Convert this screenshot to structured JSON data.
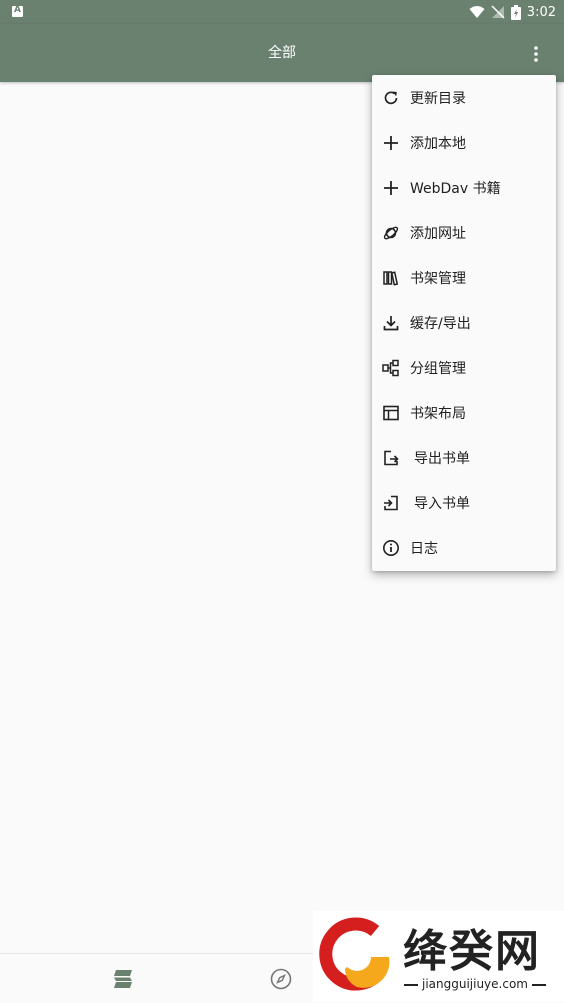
{
  "status_bar": {
    "left_badge": "A",
    "time": "3:02"
  },
  "app_bar": {
    "title": "全部",
    "more_icon": "more-vert-icon"
  },
  "menu": {
    "items": [
      {
        "label": "更新目录",
        "icon": "refresh-icon"
      },
      {
        "label": "添加本地",
        "icon": "plus-icon"
      },
      {
        "label": "WebDav 书籍",
        "icon": "plus-icon"
      },
      {
        "label": "添加网址",
        "icon": "planet-icon"
      },
      {
        "label": "书架管理",
        "icon": "bookshelf-icon"
      },
      {
        "label": "缓存/导出",
        "icon": "download-icon"
      },
      {
        "label": "分组管理",
        "icon": "group-icon"
      },
      {
        "label": "书架布局",
        "icon": "layout-icon"
      },
      {
        "label": "导出书单",
        "icon": "export-icon"
      },
      {
        "label": "导入书单",
        "icon": "import-icon"
      },
      {
        "label": "日志",
        "icon": "info-icon"
      }
    ]
  },
  "bottom_nav": {
    "items": [
      {
        "name": "bookshelf",
        "icon": "bookshelf-tab-icon",
        "active": true
      },
      {
        "name": "discover",
        "icon": "compass-icon",
        "active": false
      }
    ]
  },
  "watermark": {
    "text": "绛癸网",
    "url": "jiangguijiuye.com"
  },
  "colors": {
    "primary": "#6b8170",
    "menu_bg": "#fafafa",
    "text": "#212121"
  }
}
